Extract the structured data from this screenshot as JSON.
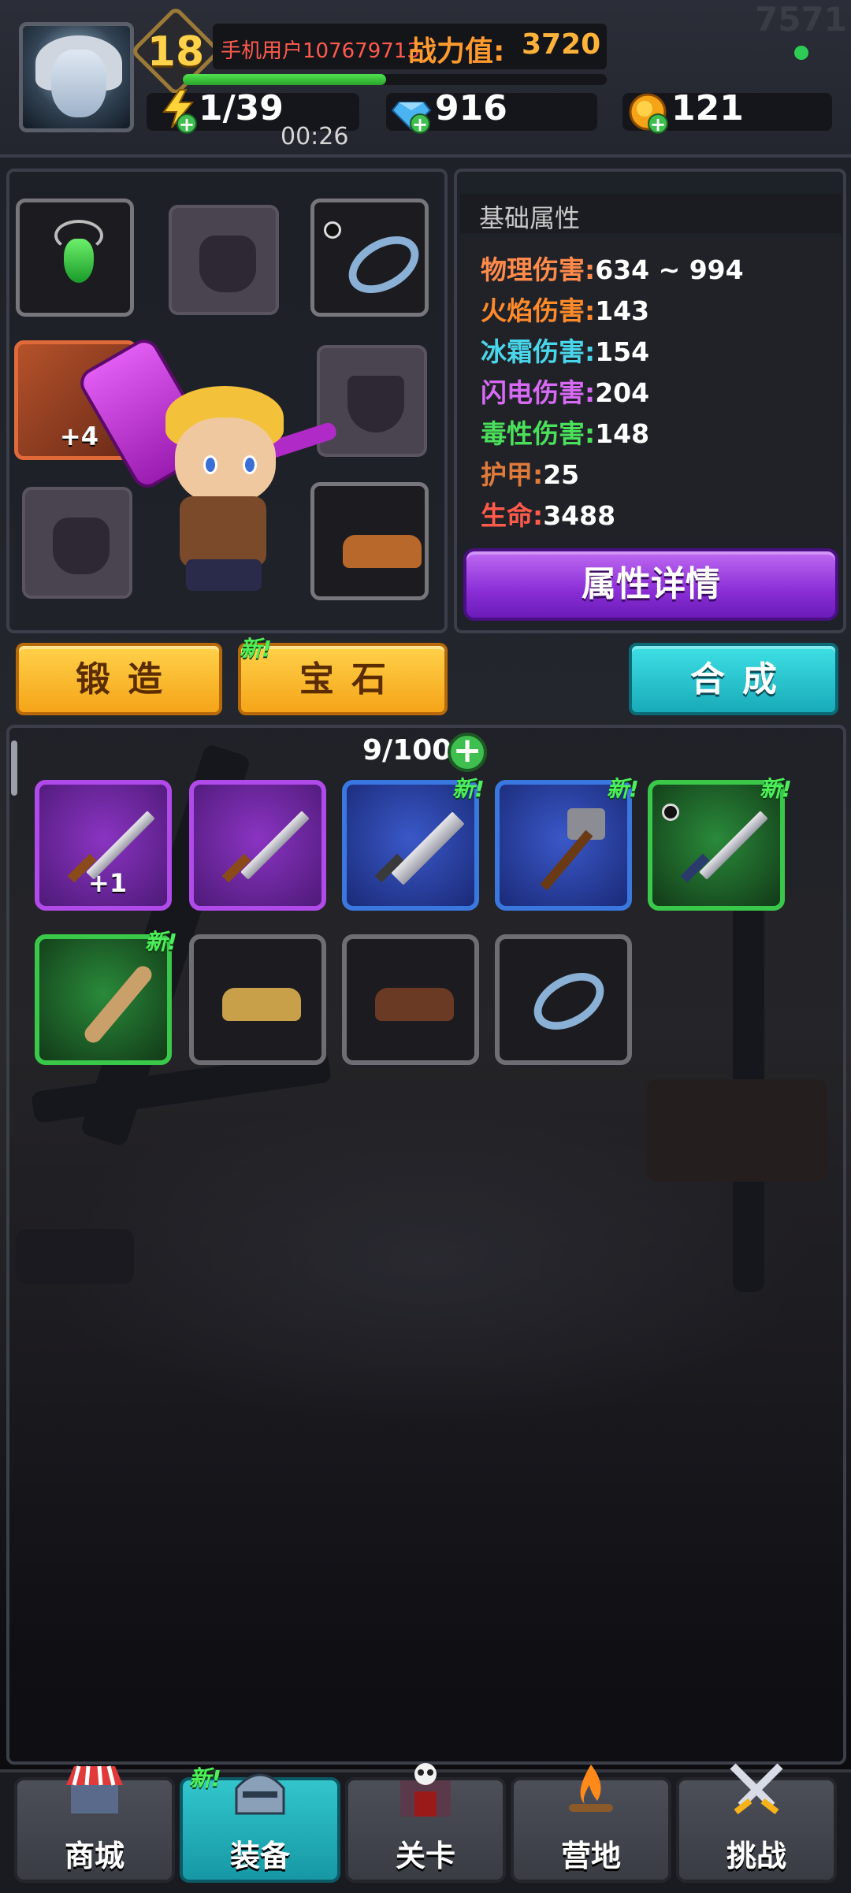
{
  "header": {
    "level": "18",
    "username": "手机用户107679713",
    "power_label": "战力值:",
    "power_value": "3720",
    "xp_fraction": 0.48,
    "corner_number": "7571",
    "energy": "1/39",
    "energy_timer": "00:26",
    "gems": "916",
    "gold": "121"
  },
  "equipment": {
    "weapon_upgrade": "+4"
  },
  "stats": {
    "title": "基础属性",
    "rows": [
      {
        "label": "物理伤害:",
        "value": "634 ~ 994",
        "color": "#ff8a4a"
      },
      {
        "label": "火焰伤害:",
        "value": "143",
        "color": "#ff8a2a"
      },
      {
        "label": "冰霜伤害:",
        "value": "154",
        "color": "#4ad6ea"
      },
      {
        "label": "闪电伤害:",
        "value": "204",
        "color": "#d66af2"
      },
      {
        "label": "毒性伤害:",
        "value": "148",
        "color": "#4ae05a"
      },
      {
        "label": "护甲:",
        "value": "25",
        "color": "#e07a3a"
      },
      {
        "label": "生命:",
        "value": "3488",
        "color": "#ff5a4a"
      }
    ],
    "details_button": "属性详情"
  },
  "tabs": {
    "forge": "锻造",
    "gem": "宝石",
    "gem_new": "新!",
    "synthesize": "合成"
  },
  "inventory": {
    "capacity": "9/100",
    "new_tag": "新!",
    "items": [
      {
        "type": "sword",
        "rarity": "purple",
        "upgrade": "+1"
      },
      {
        "type": "sword",
        "rarity": "purple"
      },
      {
        "type": "greatsword",
        "rarity": "blue",
        "is_new": true
      },
      {
        "type": "hammer",
        "rarity": "blue",
        "is_new": true
      },
      {
        "type": "sword",
        "rarity": "green",
        "is_new": true
      },
      {
        "type": "spiked-club",
        "rarity": "green",
        "is_new": true
      },
      {
        "type": "boots",
        "rarity": "grey"
      },
      {
        "type": "boots",
        "rarity": "grey"
      },
      {
        "type": "ring",
        "rarity": "grey"
      }
    ]
  },
  "nav": {
    "shop": "商城",
    "equip": "装备",
    "equip_new": "新!",
    "stage": "关卡",
    "camp": "营地",
    "challenge": "挑战"
  }
}
